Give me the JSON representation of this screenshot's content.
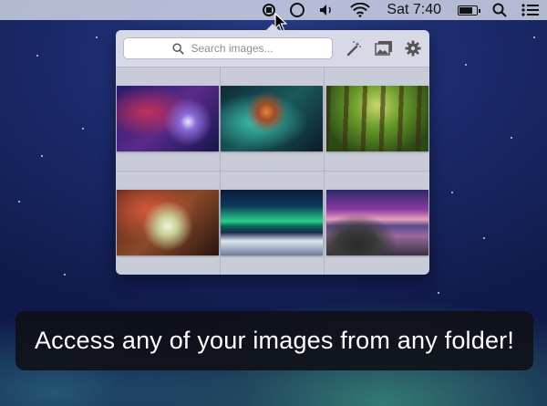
{
  "menubar": {
    "clock": "Sat 7:40",
    "icons": [
      "stop-record-icon",
      "imageshack-ring-icon",
      "volume-icon",
      "wifi-icon",
      "battery-charging-icon",
      "spotlight-search-icon",
      "notification-center-icon"
    ]
  },
  "popover": {
    "search": {
      "placeholder": "Search images...",
      "value": ""
    },
    "toolbar_icons": [
      "magic-wand-icon",
      "photos-icon",
      "gear-icon"
    ],
    "images": [
      {
        "subject": "nebula-purple"
      },
      {
        "subject": "nebula-teal"
      },
      {
        "subject": "forest"
      },
      {
        "subject": "orion-nebula"
      },
      {
        "subject": "aurora"
      },
      {
        "subject": "sunset-lake"
      }
    ]
  },
  "caption": {
    "text": "Access any of your images from any folder!"
  },
  "colors": {
    "menubar": "#d7dae6",
    "popover": "#c9ccd8",
    "caption_bg": "#0f0f14"
  }
}
